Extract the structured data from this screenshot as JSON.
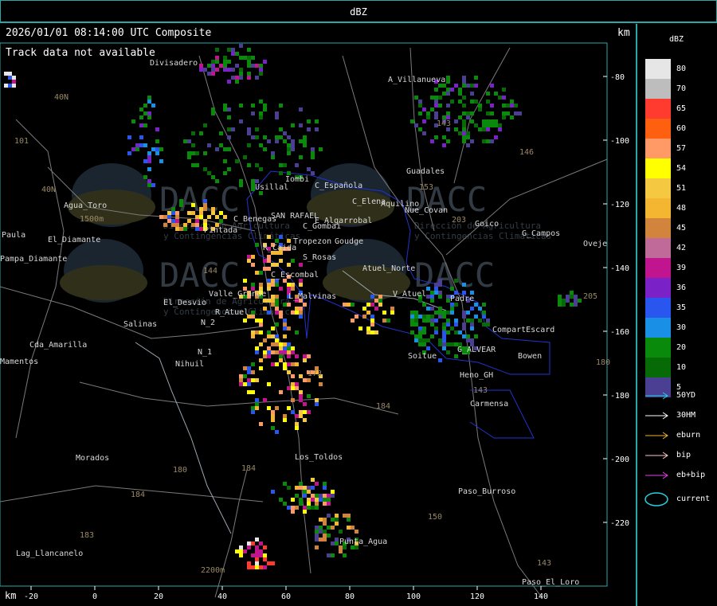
{
  "title_bar": "dBZ",
  "header": {
    "timestamp": "2026/01/01 08:14:00 UTC Composite",
    "unit_km": "km",
    "track_msg": "Track data not available"
  },
  "legend": {
    "title": "dBZ",
    "levels": [
      {
        "value": "80",
        "color": "#e6e6e6"
      },
      {
        "value": "70",
        "color": "#bdbdbd"
      },
      {
        "value": "65",
        "color": "#ff3a2e"
      },
      {
        "value": "60",
        "color": "#ff6010"
      },
      {
        "value": "57",
        "color": "#ff9a66"
      },
      {
        "value": "54",
        "color": "#ffff00"
      },
      {
        "value": "51",
        "color": "#f5c842"
      },
      {
        "value": "48",
        "color": "#f4b530"
      },
      {
        "value": "45",
        "color": "#d3843c"
      },
      {
        "value": "42",
        "color": "#c06a9a"
      },
      {
        "value": "39",
        "color": "#c0158f"
      },
      {
        "value": "36",
        "color": "#7a22c8"
      },
      {
        "value": "35",
        "color": "#2a56f0"
      },
      {
        "value": "30",
        "color": "#1a8fe6"
      },
      {
        "value": "20",
        "color": "#0a8a0a"
      },
      {
        "value": "10",
        "color": "#066a06"
      },
      {
        "value": "5",
        "color": "#4b3f94"
      }
    ],
    "tracks": [
      {
        "label": "50YD",
        "color": "#22d3e6"
      },
      {
        "label": "30HM",
        "color": "#ffffff"
      },
      {
        "label": "eburn",
        "color": "#f0b232"
      },
      {
        "label": "bip",
        "color": "#ffc8c8"
      },
      {
        "label": "eb+bip",
        "color": "#e63ee6"
      }
    ],
    "current_label": "current",
    "current_color": "#22d3e6"
  },
  "axes": {
    "x_unit": "km",
    "x_ticks": [
      "-20",
      "0",
      "20",
      "40",
      "60",
      "80",
      "100",
      "120",
      "140"
    ],
    "y_unit": "km",
    "y_ticks": [
      "-80",
      "-100",
      "-120",
      "-140",
      "-160",
      "-180",
      "-200",
      "-220"
    ]
  },
  "place_labels": [
    "Divisadero",
    "A_Villanueva",
    "Guadales",
    "Iombi",
    "Usillal",
    "C_Española",
    "C_Elena",
    "Aquilino",
    "Nue_Covan",
    "Goico",
    "G_Campos",
    "Oveje",
    "Agua_Toro",
    "El_Diamante",
    "Paula",
    "Pampa_Diamante",
    "Pintada",
    "C_Benegas",
    "SAN RAFAEL",
    "E_Algarrobal",
    "C_Gombai",
    "Tropezon",
    "Goudge",
    "R_Atuel",
    "S_Rosas",
    "R_Caida",
    "C_Escombal",
    "Atuel_Norte",
    "V_Atuel",
    "Padre",
    "El_Desvio",
    "Valle_Grande",
    "L_Malvinas",
    "Salinas",
    "N_2",
    "CompartEscard",
    "Soitue",
    "G_ALVEAR",
    "Bowen",
    "Heno_GH",
    "Cda_Amarilla",
    "Mamentos",
    "N_1",
    "Nihuil",
    "Carmensa",
    "Morados",
    "Los_Toldos",
    "Paso_Burroso",
    "Punta_Agua",
    "Lag_Llancanelo",
    "Paso_El_Loro"
  ],
  "route_labels": [
    "40N",
    "101",
    "40N",
    "146",
    "143",
    "203",
    "173",
    "184",
    "180",
    "184",
    "184",
    "150",
    "143",
    "153",
    "205",
    "183",
    "144",
    "180",
    "143",
    "1500m",
    "2200m"
  ],
  "watermark_text": "DACC",
  "watermark_sub_1": "Dirección de Agricultura",
  "watermark_sub_2": "y Contingencias Climáticas"
}
